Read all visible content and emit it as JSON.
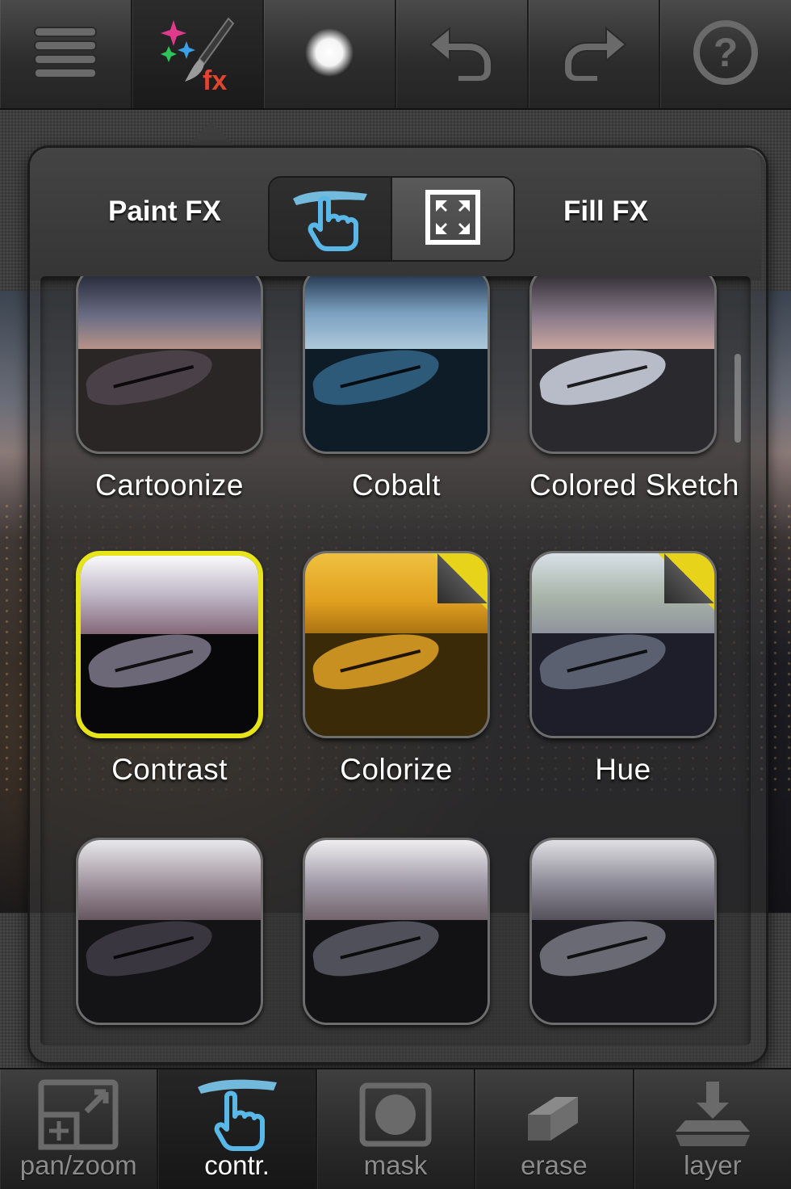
{
  "colors": {
    "accent_selected_border": "#e8e41a",
    "premium_corner": "#e6d31a",
    "touch_icon_blue": "#5ab8e8"
  },
  "top_toolbar": {
    "items": [
      {
        "icon": "menu-icon"
      },
      {
        "icon": "fx-paint-icon",
        "active": true
      },
      {
        "icon": "brush-size-icon"
      },
      {
        "icon": "undo-icon"
      },
      {
        "icon": "redo-icon"
      },
      {
        "icon": "help-icon"
      }
    ]
  },
  "fx_panel": {
    "paint_fx_label": "Paint FX",
    "fill_fx_label": "Fill FX",
    "mode_toggle": {
      "options": [
        {
          "icon": "finger-touch-icon",
          "selected": true
        },
        {
          "icon": "fullscreen-fill-icon",
          "selected": false
        }
      ]
    },
    "effects": [
      {
        "name": "Cartoonize",
        "selected": false,
        "premium": false
      },
      {
        "name": "Cobalt",
        "selected": false,
        "premium": false
      },
      {
        "name": "Colored Sketch",
        "selected": false,
        "premium": false
      },
      {
        "name": "Contrast",
        "selected": true,
        "premium": false
      },
      {
        "name": "Colorize",
        "selected": false,
        "premium": true
      },
      {
        "name": "Hue",
        "selected": false,
        "premium": true
      },
      {
        "name": "",
        "selected": false,
        "premium": false
      },
      {
        "name": "",
        "selected": false,
        "premium": false
      },
      {
        "name": "",
        "selected": false,
        "premium": false
      }
    ]
  },
  "bottom_toolbar": {
    "items": [
      {
        "label": "pan/zoom",
        "icon": "pan-zoom-icon",
        "active": false
      },
      {
        "label": "contr.",
        "icon": "finger-touch-icon",
        "active": true
      },
      {
        "label": "mask",
        "icon": "mask-icon",
        "active": false
      },
      {
        "label": "erase",
        "icon": "eraser-icon",
        "active": false
      },
      {
        "label": "layer",
        "icon": "layer-icon",
        "active": false
      }
    ]
  }
}
